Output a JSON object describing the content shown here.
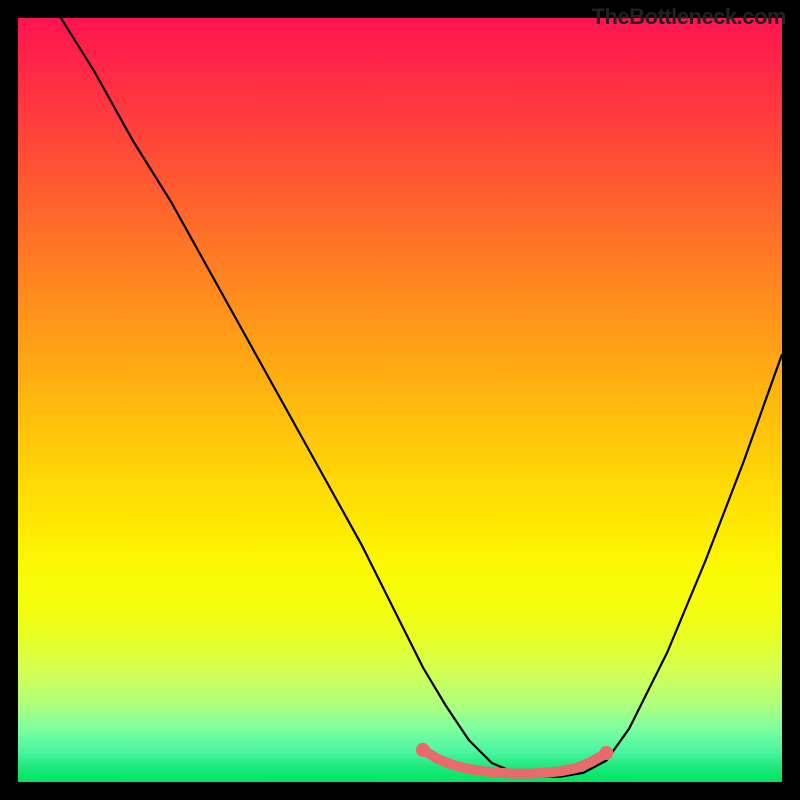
{
  "watermark": "TheBottleneck.com",
  "chart_data": {
    "type": "line",
    "title": "",
    "xlabel": "",
    "ylabel": "",
    "xlim": [
      0,
      100
    ],
    "ylim": [
      0,
      100
    ],
    "series": [
      {
        "name": "curve",
        "x": [
          0,
          5,
          10,
          15,
          20,
          25,
          30,
          35,
          40,
          45,
          50,
          53,
          56,
          59,
          62,
          65,
          68,
          71,
          74,
          77,
          80,
          85,
          90,
          95,
          100
        ],
        "y": [
          108,
          101,
          93,
          84,
          76,
          67,
          58,
          49,
          40,
          31,
          21,
          15,
          10,
          5.5,
          2.5,
          1.2,
          0.7,
          0.7,
          1.2,
          2.8,
          7,
          17,
          29,
          42,
          56
        ]
      },
      {
        "name": "marker-band",
        "x": [
          53,
          55,
          57,
          59,
          61,
          63,
          65,
          67,
          69,
          71,
          73,
          75,
          77
        ],
        "y": [
          4.2,
          3.0,
          2.2,
          1.7,
          1.4,
          1.2,
          1.1,
          1.1,
          1.2,
          1.4,
          1.8,
          2.6,
          3.8
        ]
      }
    ],
    "gradient_stops": [
      {
        "pos": 0,
        "color": "#ff1351"
      },
      {
        "pos": 50,
        "color": "#ffb80f"
      },
      {
        "pos": 78,
        "color": "#f2fe10"
      },
      {
        "pos": 100,
        "color": "#00e55c"
      }
    ]
  }
}
